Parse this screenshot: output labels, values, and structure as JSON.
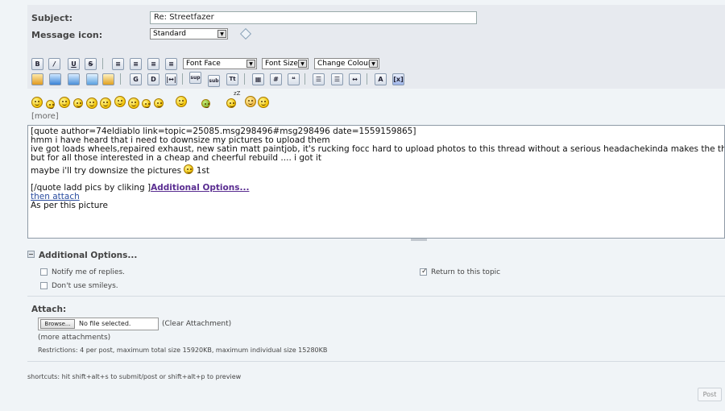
{
  "form": {
    "subject_label": "Subject:",
    "subject_value": "Re: Streetfazer",
    "message_icon_label": "Message icon:",
    "message_icon_value": "Standard"
  },
  "toolbar": {
    "row1": [
      "B",
      "I",
      "U",
      "S",
      "left",
      "center",
      "right",
      "justify"
    ],
    "font_face": "Font Face",
    "font_size": "Font Size",
    "change_colour": "Change Colour",
    "row2_icons": [
      "flash-icon",
      "image-icon",
      "link-icon",
      "email-icon",
      "ftp-icon",
      "glow-icon",
      "shadow-icon",
      "marquee-icon",
      "superscript-icon",
      "subscript-icon",
      "teletype-icon",
      "table-icon",
      "code-icon",
      "quote-icon",
      "bullet-list-icon",
      "numbered-list-icon",
      "horizontal-rule-icon",
      "remove-format-icon",
      "toggle-view-icon"
    ],
    "row2_labels": {
      "sup": "sup",
      "sub": "sub",
      "tt": "Tt",
      "code": "#"
    }
  },
  "smileys": {
    "more_label": "[more]",
    "zz_label": "zZ"
  },
  "message": {
    "line1": "[quote author=74eldiablo link=topic=25085.msg298496#msg298496 date=1559159865]",
    "line2": "hmm i have heard that i need to downsize my pictures to upload them",
    "line3": "ive got loads wheels,repaired exhaust, new satin matt paintjob, it's rucking focc hard to upload photos to this thread without a serious headachekinda makes the thread shit",
    "line4": "but for all those interested in a cheap and cheerful rebuild .... i got it",
    "line5_prefix": "maybe i'll try downsize the pictures",
    "line5_suffix": "1st",
    "line6_prefix": "[/quote ladd pics by cliking ]",
    "line6_link": "Additional Options...",
    "line7": "then attach",
    "line8": "As per this picture"
  },
  "additional_options": {
    "title": "Additional Options...",
    "notify_label": "Notify me of replies.",
    "notify_checked": false,
    "smileys_label": "Don't use smileys.",
    "smileys_checked": false,
    "return_label": "Return to this topic",
    "return_checked": true
  },
  "attach": {
    "title": "Attach:",
    "browse_label": "Browse...",
    "no_file": "No file selected.",
    "clear": "(Clear Attachment)",
    "more": "(more attachments)",
    "restrictions": "Restrictions: 4 per post, maximum total size 15920KB, maximum individual size 15280KB"
  },
  "footer": {
    "shortcuts": "shortcuts: hit shift+alt+s to submit/post or shift+alt+p to preview",
    "post_label": "Post"
  }
}
